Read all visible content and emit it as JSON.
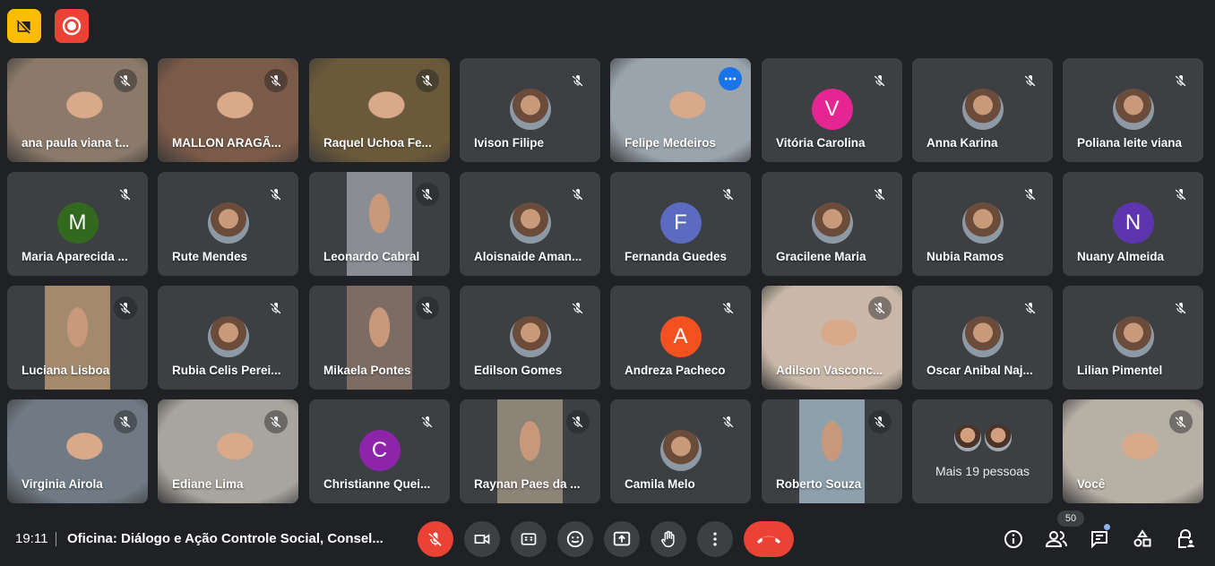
{
  "top_icons": {
    "camera_status": "camera-off-icon",
    "recording": "record-icon"
  },
  "tiles": [
    {
      "name": "ana paula viana t...",
      "kind": "video",
      "bg": "#8b7a6a"
    },
    {
      "name": "MALLON ARAGÃ...",
      "kind": "video",
      "bg": "#7a5a48"
    },
    {
      "name": "Raquel Uchoa Fe...",
      "kind": "video",
      "bg": "#6a5a3a"
    },
    {
      "name": "Ivison Filipe",
      "kind": "photo"
    },
    {
      "name": "Felipe Medeiros",
      "kind": "video",
      "bg": "#9aa4ad",
      "active": true
    },
    {
      "name": "Vitória Carolina",
      "kind": "letter",
      "letter": "V",
      "color": "#e52592"
    },
    {
      "name": "Anna Karina",
      "kind": "photo"
    },
    {
      "name": "Poliana leite viana",
      "kind": "photo"
    },
    {
      "name": "Maria Aparecida ...",
      "kind": "letter",
      "letter": "M",
      "color": "#33691e"
    },
    {
      "name": "Rute Mendes",
      "kind": "photo"
    },
    {
      "name": "Leonardo Cabral",
      "kind": "strip",
      "bg": "#8a8e94"
    },
    {
      "name": "Aloisnaide Aman...",
      "kind": "photo"
    },
    {
      "name": "Fernanda Guedes",
      "kind": "letter",
      "letter": "F",
      "color": "#5c6bc0"
    },
    {
      "name": "Gracilene Maria",
      "kind": "photo"
    },
    {
      "name": "Nubia Ramos",
      "kind": "photo"
    },
    {
      "name": "Nuany Almeida",
      "kind": "letter",
      "letter": "N",
      "color": "#5e35b1"
    },
    {
      "name": "Luciana Lisboa",
      "kind": "strip",
      "bg": "#a38a6c"
    },
    {
      "name": "Rubia Celis Perei...",
      "kind": "photo"
    },
    {
      "name": "Mikaela Pontes",
      "kind": "strip",
      "bg": "#7c6c63"
    },
    {
      "name": "Edilson Gomes",
      "kind": "photo"
    },
    {
      "name": "Andreza Pacheco",
      "kind": "letter",
      "letter": "A",
      "color": "#f4511e"
    },
    {
      "name": "Adilson Vasconc...",
      "kind": "video",
      "bg": "#c9b8a8"
    },
    {
      "name": "Oscar Anibal Naj...",
      "kind": "photo"
    },
    {
      "name": "Lilian Pimentel",
      "kind": "photo"
    },
    {
      "name": "Virginia Airola",
      "kind": "video",
      "bg": "#6f7a84"
    },
    {
      "name": "Ediane Lima",
      "kind": "video",
      "bg": "#a8a59e"
    },
    {
      "name": "Christianne Quei...",
      "kind": "letter",
      "letter": "C",
      "color": "#8e24aa"
    },
    {
      "name": "Raynan Paes da ...",
      "kind": "strip",
      "bg": "#8d8478"
    },
    {
      "name": "Camila Melo",
      "kind": "photo"
    },
    {
      "name": "Roberto Souza",
      "kind": "strip",
      "bg": "#8fa0ad"
    },
    {
      "name": "Mais 19 pessoas",
      "kind": "more"
    },
    {
      "name": "Você",
      "kind": "video",
      "bg": "#b7b0a5"
    }
  ],
  "footer": {
    "time": "19:11",
    "meeting_title": "Oficina: Diálogo e Ação Controle Social, Consel...",
    "people_count": "50"
  },
  "colors": {
    "background": "#202124",
    "tile": "#3c4043",
    "danger": "#ea4335",
    "accent": "#8ab4f8"
  }
}
